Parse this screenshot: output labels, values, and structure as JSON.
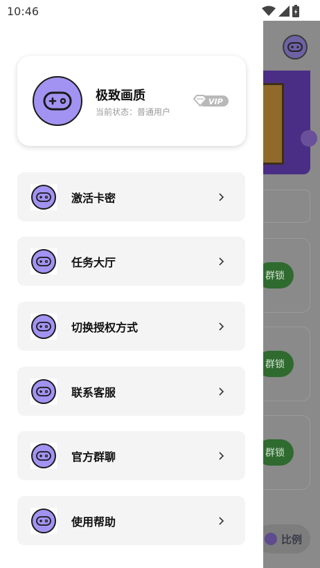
{
  "status_bar": {
    "time": "10:46",
    "icons": [
      "wifi-icon",
      "signal-icon",
      "battery-icon"
    ]
  },
  "colors": {
    "accent_purple": "#a293f2",
    "card_gray": "#f4f4f4",
    "scrim_gray": "#8a8a8a"
  },
  "profile": {
    "title": "极致画质",
    "status": "当前状态：普通用户",
    "badge": "VIP"
  },
  "menu": {
    "items": [
      {
        "label": "激活卡密",
        "icon": "gamepad-icon"
      },
      {
        "label": "任务大厅",
        "icon": "gamepad-icon"
      },
      {
        "label": "切换授权方式",
        "icon": "gamepad-icon"
      },
      {
        "label": "联系客服",
        "icon": "gamepad-icon"
      },
      {
        "label": "官方群聊",
        "icon": "gamepad-icon"
      },
      {
        "label": "使用帮助",
        "icon": "gamepad-icon"
      }
    ]
  },
  "background_app": {
    "lock_buttons": [
      "群锁",
      "群锁",
      "群锁"
    ],
    "ratio_label": "比例"
  }
}
